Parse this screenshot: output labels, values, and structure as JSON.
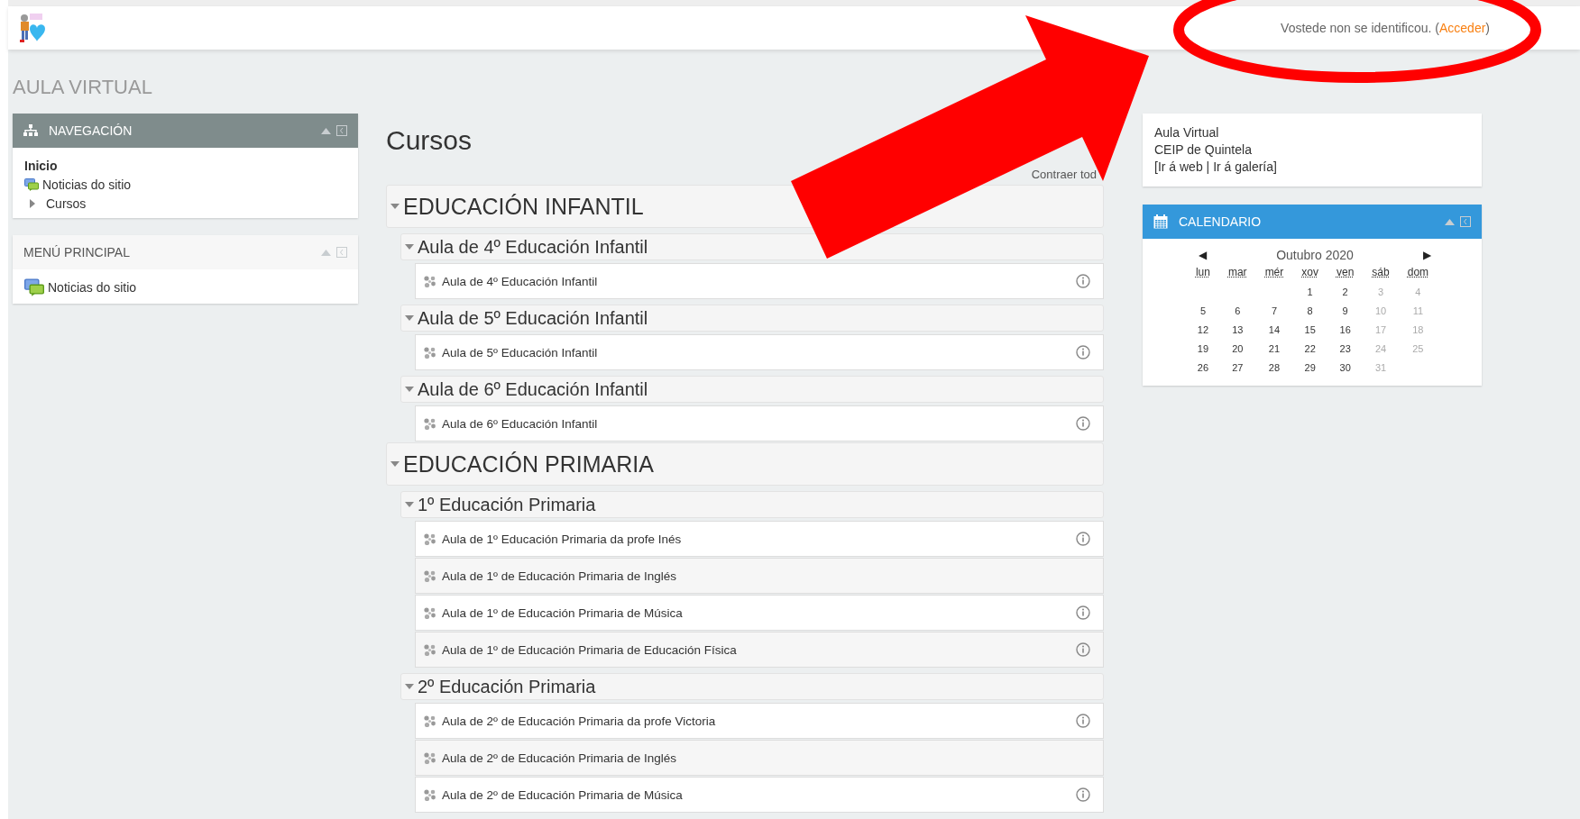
{
  "header": {
    "login_notice": {
      "text_before": "Vostede non se identificou. (",
      "link": "Acceder",
      "text_after": ")"
    }
  },
  "site_title": "AULA VIRTUAL",
  "navigation": {
    "title": "NAVEGACIÓN",
    "items": [
      {
        "label": "Inicio",
        "kind": "home"
      },
      {
        "label": "Noticias do sitio",
        "kind": "forum"
      },
      {
        "label": "Cursos",
        "kind": "branch",
        "expanded": false
      }
    ]
  },
  "main_menu": {
    "title": "MENÚ PRINCIPAL",
    "items": [
      {
        "label": "Noticias do sitio"
      }
    ]
  },
  "courses": {
    "title": "Cursos",
    "collapse_all": "Contraer tod",
    "categories": [
      {
        "name": "EDUCACIÓN INFANTIL",
        "expanded": true,
        "children": [
          {
            "name": "Aula de 4º Educación Infantil",
            "expanded": true,
            "courses": [
              {
                "name": "Aula de 4º Educación Infantil",
                "has_summary": true
              }
            ]
          },
          {
            "name": "Aula de 5º Educación Infantil",
            "expanded": true,
            "courses": [
              {
                "name": "Aula de 5º Educación Infantil",
                "has_summary": true
              }
            ]
          },
          {
            "name": "Aula de 6º Educación Infantil",
            "expanded": true,
            "courses": [
              {
                "name": "Aula de 6º Educación Infantil",
                "has_summary": true
              }
            ]
          }
        ]
      },
      {
        "name": "EDUCACIÓN PRIMARIA",
        "expanded": true,
        "children": [
          {
            "name": "1º Educación Primaria",
            "expanded": true,
            "courses": [
              {
                "name": "Aula de 1º Educación Primaria da profe Inés",
                "has_summary": true
              },
              {
                "name": "Aula de 1º de Educación Primaria de Inglés",
                "has_summary": false
              },
              {
                "name": "Aula de 1º de Educación Primaria de Música",
                "has_summary": true
              },
              {
                "name": "Aula de 1º de Educación Primaria de Educación Física",
                "has_summary": true
              }
            ]
          },
          {
            "name": "2º Educación Primaria",
            "expanded": true,
            "courses": [
              {
                "name": "Aula de 2º de Educación Primaria da profe Victoria",
                "has_summary": true
              },
              {
                "name": "Aula de 2º de Educación Primaria de Inglés",
                "has_summary": false
              },
              {
                "name": "Aula de 2º de Educación Primaria de Música",
                "has_summary": true
              }
            ]
          }
        ]
      }
    ]
  },
  "info_block": {
    "lines": [
      "Aula Virtual",
      "CEIP de Quintela"
    ],
    "bracket_open": "[",
    "links": [
      "Ir á web",
      "Ir á galería"
    ],
    "separator": "|",
    "bracket_close": "]"
  },
  "calendar": {
    "title": "CALENDARIO",
    "prev": "◀",
    "month": "Outubro 2020",
    "next": "▶",
    "weekdays": [
      "lun",
      "mar",
      "mér",
      "xov",
      "ven",
      "sáb",
      "dom"
    ],
    "weeks": [
      [
        {
          "day": "1",
          "muted": false
        },
        {
          "day": "2",
          "muted": false
        },
        {
          "day": "3",
          "muted": true
        },
        {
          "day": "4",
          "muted": true
        }
      ],
      [
        {
          "day": "5",
          "muted": false
        },
        {
          "day": "6",
          "muted": false
        },
        {
          "day": "7",
          "muted": false
        },
        {
          "day": "8",
          "muted": false
        },
        {
          "day": "9",
          "muted": false
        },
        {
          "day": "10",
          "muted": true
        },
        {
          "day": "11",
          "muted": true
        }
      ],
      [
        {
          "day": "12",
          "muted": false
        },
        {
          "day": "13",
          "muted": false
        },
        {
          "day": "14",
          "muted": false
        },
        {
          "day": "15",
          "muted": false
        },
        {
          "day": "16",
          "muted": false
        },
        {
          "day": "17",
          "muted": true
        },
        {
          "day": "18",
          "muted": true
        }
      ],
      [
        {
          "day": "19",
          "muted": false
        },
        {
          "day": "20",
          "muted": false
        },
        {
          "day": "21",
          "muted": false
        },
        {
          "day": "22",
          "muted": false
        },
        {
          "day": "23",
          "muted": false
        },
        {
          "day": "24",
          "muted": true
        },
        {
          "day": "25",
          "muted": true
        }
      ],
      [
        {
          "day": "26",
          "muted": false
        },
        {
          "day": "27",
          "muted": false
        },
        {
          "day": "28",
          "muted": false
        },
        {
          "day": "29",
          "muted": false
        },
        {
          "day": "30",
          "muted": false
        },
        {
          "day": "31",
          "muted": true
        }
      ]
    ]
  },
  "annotations": [
    {
      "kind": "arrow"
    },
    {
      "kind": "ellipse"
    }
  ]
}
